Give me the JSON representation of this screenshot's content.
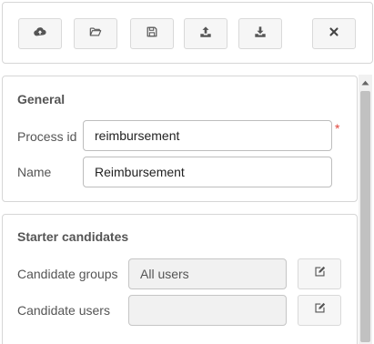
{
  "toolbar": {
    "buttons": [
      {
        "icon": "cloud-upload-icon"
      },
      {
        "icon": "folder-open-icon"
      },
      {
        "icon": "save-icon"
      },
      {
        "icon": "upload-icon"
      },
      {
        "icon": "download-icon"
      },
      {
        "icon": "close-icon"
      }
    ]
  },
  "general": {
    "title": "General",
    "process_id_label": "Process id",
    "process_id_value": "reimbursement",
    "required_mark": "*",
    "name_label": "Name",
    "name_value": "Reimbursement"
  },
  "starter": {
    "title": "Starter candidates",
    "groups_label": "Candidate groups",
    "groups_value": "All users",
    "users_label": "Candidate users",
    "users_value": ""
  },
  "colors": {
    "required": "#e0463c",
    "icon": "#555555",
    "scroll_thumb": "#c1c1c1"
  }
}
